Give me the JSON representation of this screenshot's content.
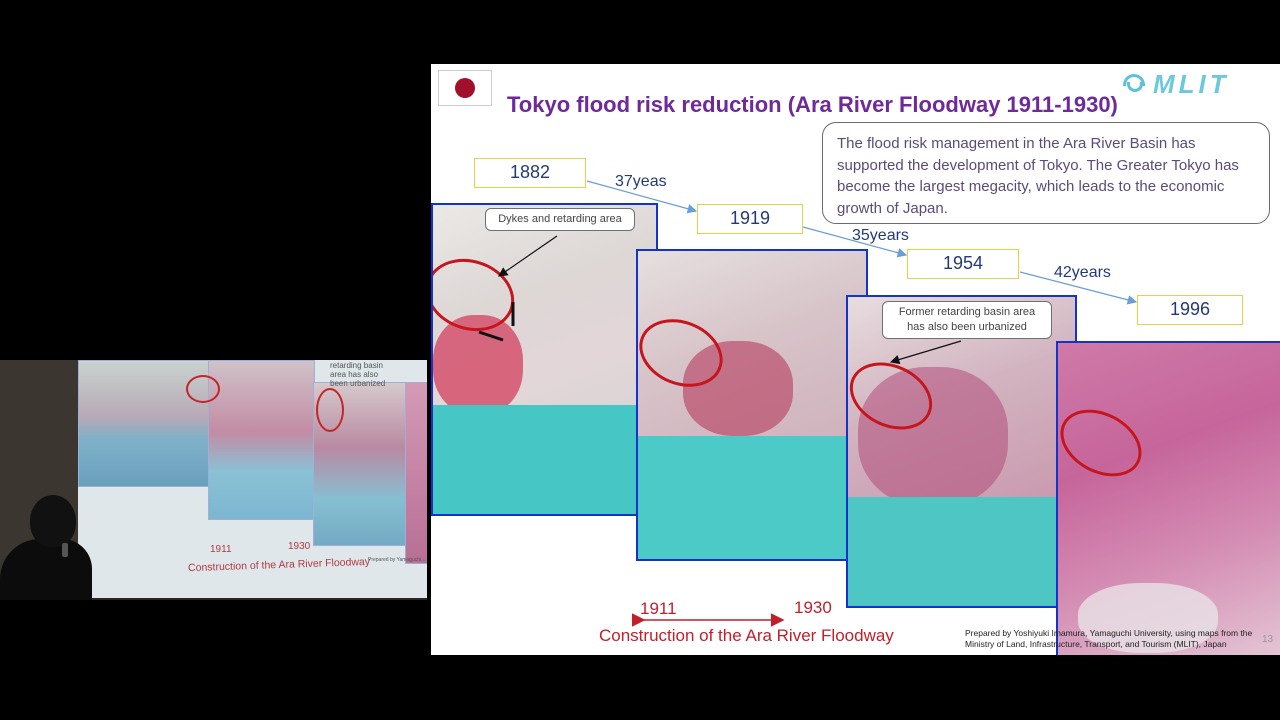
{
  "camera": {
    "screen_texts": {
      "year_start": "1911",
      "year_end": "1930",
      "construction": "Construction of the Ara River Floodway",
      "former_retarding": "retarding basin area has also been urbanized",
      "prepared": "Prepared by Yamaguchi..."
    }
  },
  "slide": {
    "title": "Tokyo flood risk reduction (Ara River Floodway 1911-1930)",
    "logo_text": "MLIT",
    "flag_icon": "japan-flag-icon",
    "note": "The flood risk management in the Ara River Basin has supported the development of Tokyo.  The Greater Tokyo has become the largest megacity, which leads to the economic growth of Japan.",
    "years": [
      "1882",
      "1919",
      "1954",
      "1996"
    ],
    "gaps": [
      "37yeas",
      "35years",
      "42years"
    ],
    "callouts": {
      "dykes": "Dykes and retarding area",
      "former": "Former retarding basin area has also been urbanized"
    },
    "construction": {
      "start": "1911",
      "end": "1930",
      "label": "Construction of the Ara River Floodway"
    },
    "credit": "Prepared  by Yoshiyuki Imamura,  Yamaguchi University, using maps from the Ministry of Land, Infrastructure, Transport, and Tourism (MLIT),  Japan",
    "page_number": "13"
  },
  "colors": {
    "title": "#6f2a99",
    "year_box_border": "#e0d24a",
    "map_border": "#1433c8",
    "ellipse": "#c4161c",
    "construction": "#c11f2a",
    "arrow": "#6a9ed8"
  }
}
